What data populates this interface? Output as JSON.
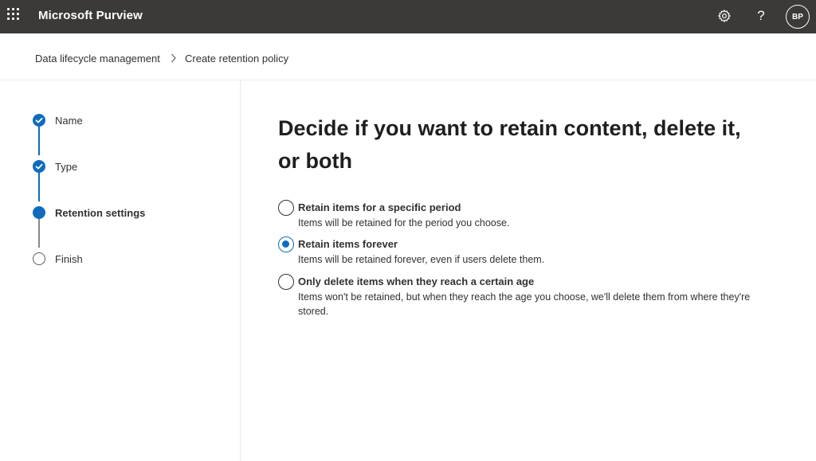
{
  "topbar": {
    "app_title": "Microsoft Purview",
    "icons": {
      "waffle": "waffle-icon",
      "settings": "gear-icon",
      "help": "help-icon"
    },
    "help_glyph": "?",
    "avatar_initials": "BP"
  },
  "breadcrumb": {
    "items": [
      "Data lifecycle management",
      "Create retention policy"
    ],
    "separator_icon": "chevron-right-icon"
  },
  "wizard": {
    "steps": [
      {
        "label": "Name",
        "state": "completed"
      },
      {
        "label": "Type",
        "state": "completed"
      },
      {
        "label": "Retention settings",
        "state": "current"
      },
      {
        "label": "Finish",
        "state": "not-started"
      }
    ]
  },
  "main": {
    "heading": "Decide if you want to retain content, delete it, or both",
    "options": [
      {
        "title": "Retain items for a specific period",
        "description": "Items will be retained for the period you choose.",
        "selected": false
      },
      {
        "title": "Retain items forever",
        "description": "Items will be retained forever, even if users delete them.",
        "selected": true
      },
      {
        "title": "Only delete items when they reach a certain age",
        "description": "Items won't be retained, but when they reach the age you choose, we'll delete them from where they're stored.",
        "selected": false
      }
    ]
  },
  "colors": {
    "topbar": "#3b3a39",
    "accent": "#0f6cbd",
    "text": "#323130",
    "divider": "#edebe9"
  }
}
